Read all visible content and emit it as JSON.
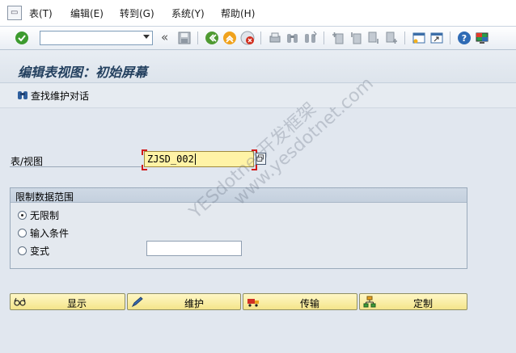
{
  "menu": {
    "items": [
      {
        "label": "表(T)"
      },
      {
        "label": "编辑(E)"
      },
      {
        "label": "转到(G)"
      },
      {
        "label": "系统(Y)"
      },
      {
        "label": "帮助(H)"
      }
    ]
  },
  "toolbar": {
    "command_value": "",
    "icons": [
      "enter-check-icon",
      "command-dropdown-icon",
      "collapse-icon",
      "save-icon",
      "back-icon",
      "exit-icon",
      "cancel-icon",
      "print-icon",
      "find-icon",
      "find-next-icon",
      "first-page-icon",
      "previous-page-icon",
      "next-page-icon",
      "last-page-icon",
      "new-session-icon",
      "shortcut-icon",
      "help-icon",
      "customize-layout-icon"
    ]
  },
  "page": {
    "title": "编辑表视图：初始屏幕"
  },
  "app_toolbar": {
    "find_label": "查找维护对话"
  },
  "form": {
    "table_label": "表/视图",
    "table_value": "ZJSD_002"
  },
  "restrict": {
    "title": "限制数据范围",
    "options": [
      {
        "label": "无限制",
        "selected": true
      },
      {
        "label": "输入条件",
        "selected": false
      },
      {
        "label": "变式",
        "selected": false
      }
    ],
    "variant_value": ""
  },
  "actions": {
    "display": "显示",
    "maintain": "维护",
    "transport": "传输",
    "customize": "定制"
  },
  "watermark": {
    "line1": "YESdotnet开发框架",
    "line2": "www.yesdotnet.com"
  },
  "colors": {
    "accent_title": "#23405f",
    "input_required": "#fff3a6",
    "button_face": "#f4e48a"
  }
}
